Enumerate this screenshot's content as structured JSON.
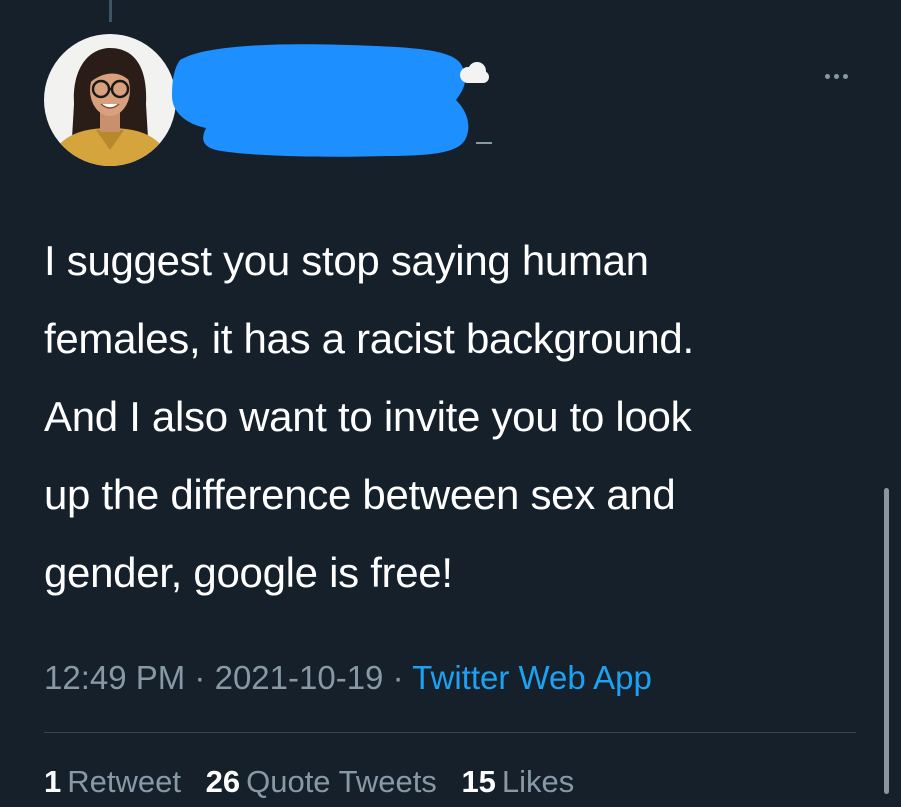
{
  "tweet": {
    "text_lines": [
      "I suggest you stop saying human",
      "females, it has a racist background.",
      "And I also want to invite you to look",
      "up the difference between sex and",
      "gender, google is free!"
    ],
    "time": "12:49 PM",
    "date": "2021-10-19",
    "separator": "·",
    "source": "Twitter Web App"
  },
  "stats": {
    "retweets_count": "1",
    "retweets_label": "Retweet",
    "quotes_count": "26",
    "quotes_label": "Quote Tweets",
    "likes_count": "15",
    "likes_label": "Likes"
  },
  "icons": {
    "more": "more-horizontal-icon",
    "badge": "cloud-icon"
  },
  "colors": {
    "background": "#15202b",
    "text": "#ffffff",
    "muted": "#8899a6",
    "link": "#1da1f2",
    "redaction": "#1e8fff"
  }
}
